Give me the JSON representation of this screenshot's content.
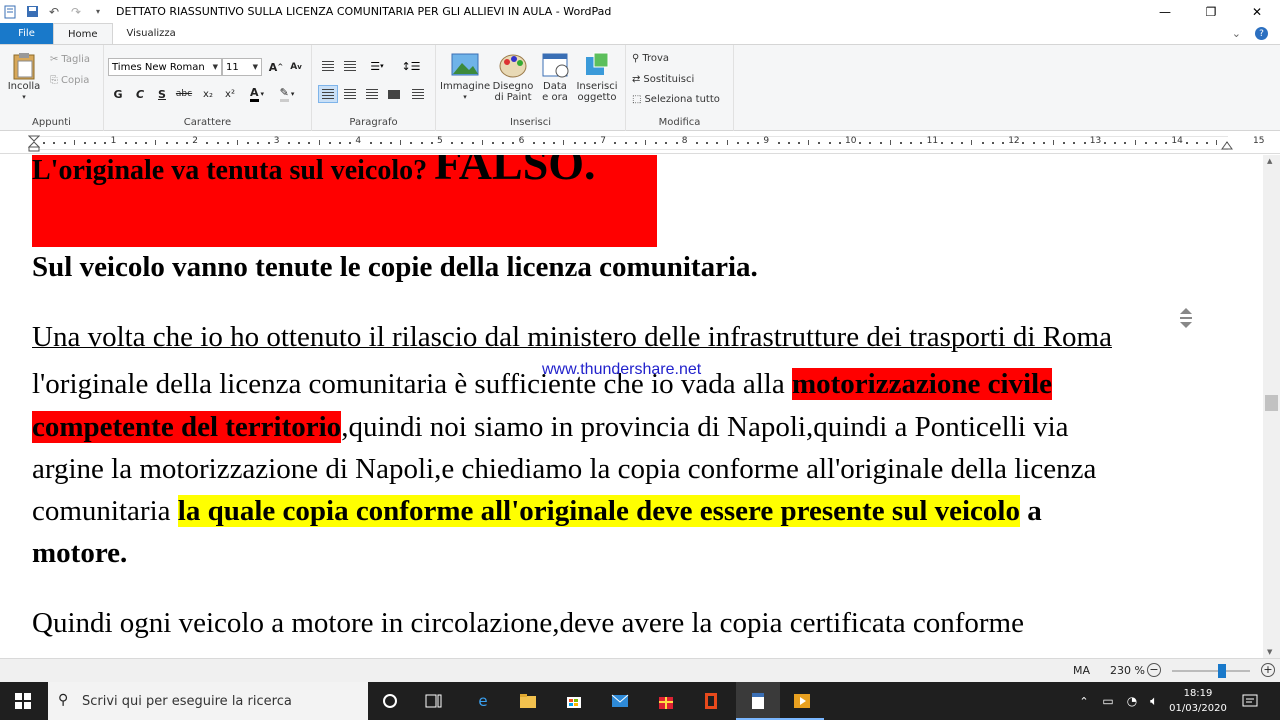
{
  "window": {
    "title": "DETTATO RIASSUNTIVO SULLA LICENZA COMUNITARIA PER GLI ALLIEVI IN AULA - WordPad",
    "controls": {
      "minimize": "—",
      "restore": "❐",
      "close": "✕"
    }
  },
  "ribbon": {
    "tabs": {
      "file": "File",
      "home": "Home",
      "view": "Visualizza"
    },
    "clipboard": {
      "paste": "Incolla",
      "cut": "Taglia",
      "copy": "Copia",
      "group": "Appunti"
    },
    "font": {
      "family": "Times New Roman",
      "size": "11",
      "group": "Carattere",
      "bold": "G",
      "italic": "C",
      "underline": "S",
      "strike": "abc",
      "sub": "x₂",
      "sup": "x²"
    },
    "paragraph": {
      "group": "Paragrafo"
    },
    "insert": {
      "image": "Immagine",
      "paint1": "Disegno",
      "paint2": "di Paint",
      "date1": "Data",
      "date2": "e ora",
      "obj1": "Inserisci",
      "obj2": "oggetto",
      "group": "Inserisci"
    },
    "edit": {
      "find": "Trova",
      "replace": "Sostituisci",
      "selectall": "Seleziona tutto",
      "group": "Modifica"
    }
  },
  "ruler": {
    "numbers": [
      "1",
      "2",
      "3",
      "4",
      "5",
      "6",
      "7",
      "8",
      "9",
      "10",
      "11",
      "12",
      "13",
      "14",
      "15"
    ]
  },
  "document": {
    "cut_line_a": "L'originale va tenuta sul veicolo? ",
    "cut_line_b": "FALSO.",
    "p1": "Sul veicolo vanno tenute le copie della licenza comunitaria.",
    "p2_l1": "Una volta che io ho ottenuto il rilascio dal ministero delle infrastrutture dei trasporti di Roma",
    "p2_l2_a": "l'originale della licenza comunitaria è sufficiente che io vada alla ",
    "p2_l2_b": "motorizzazione civile",
    "p2_l3_a": "competente del territorio",
    "p2_l3_b": ",quindi noi siamo in provincia di Napoli,quindi a Ponticelli via",
    "p2_l4": "argine la motorizzazione di Napoli,e chiediamo la copia conforme all'originale della licenza",
    "p2_l5_a": "comunitaria ",
    "p2_l5_b": "la quale copia conforme all'originale deve essere presente sul veicolo",
    "p2_l5_c": " a",
    "p2_l6": "motore.",
    "p3_l1": "Quindi ogni veicolo a motore in circolazione,deve avere la copia certificata conforme",
    "watermark": "www.thundershare.net"
  },
  "statusbar": {
    "mode": "MA",
    "zoom": "230 %",
    "minus": "−",
    "plus": "+"
  },
  "taskbar": {
    "search_placeholder": "Scrivi qui per eseguire la ricerca",
    "time": "18:19",
    "date": "01/03/2020"
  },
  "colors": {
    "accent": "#1979ca",
    "highlight_red": "#ff0000",
    "highlight_yellow": "#ffff00"
  }
}
